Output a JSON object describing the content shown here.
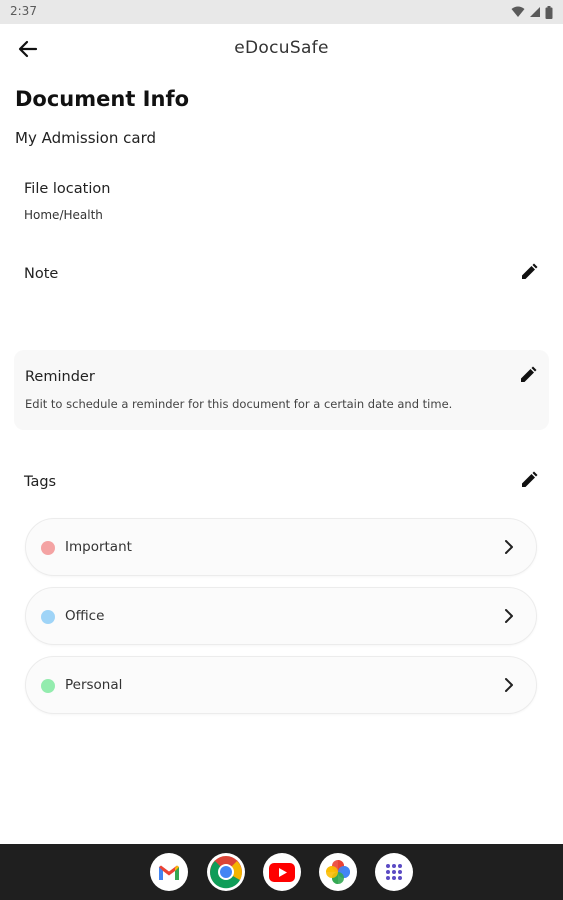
{
  "status_bar": {
    "time": "2:37"
  },
  "app_bar": {
    "title": "eDocuSafe",
    "back_icon": "arrow-left-icon"
  },
  "page": {
    "title": "Document Info",
    "document_name": "My Admission card"
  },
  "file_location": {
    "label": "File location",
    "value": "Home/Health"
  },
  "note": {
    "label": "Note",
    "edit_icon": "pencil-icon"
  },
  "reminder": {
    "title": "Reminder",
    "description": "Edit to schedule a reminder for this document for a certain date and time.",
    "edit_icon": "pencil-icon"
  },
  "tags": {
    "label": "Tags",
    "edit_icon": "pencil-icon",
    "items": [
      {
        "label": "Important",
        "color": "#f4a3a3"
      },
      {
        "label": "Office",
        "color": "#9fd4f7"
      },
      {
        "label": "Personal",
        "color": "#93ecae"
      }
    ]
  },
  "dock": {
    "apps": [
      "gmail-icon",
      "chrome-icon",
      "youtube-icon",
      "photos-icon",
      "app-drawer-icon"
    ]
  },
  "colors": {
    "reminder_card_bg": "#f8f8f8",
    "nav_bar_bg": "#1f1f1f",
    "status_bar_bg": "#e8e8e8"
  }
}
